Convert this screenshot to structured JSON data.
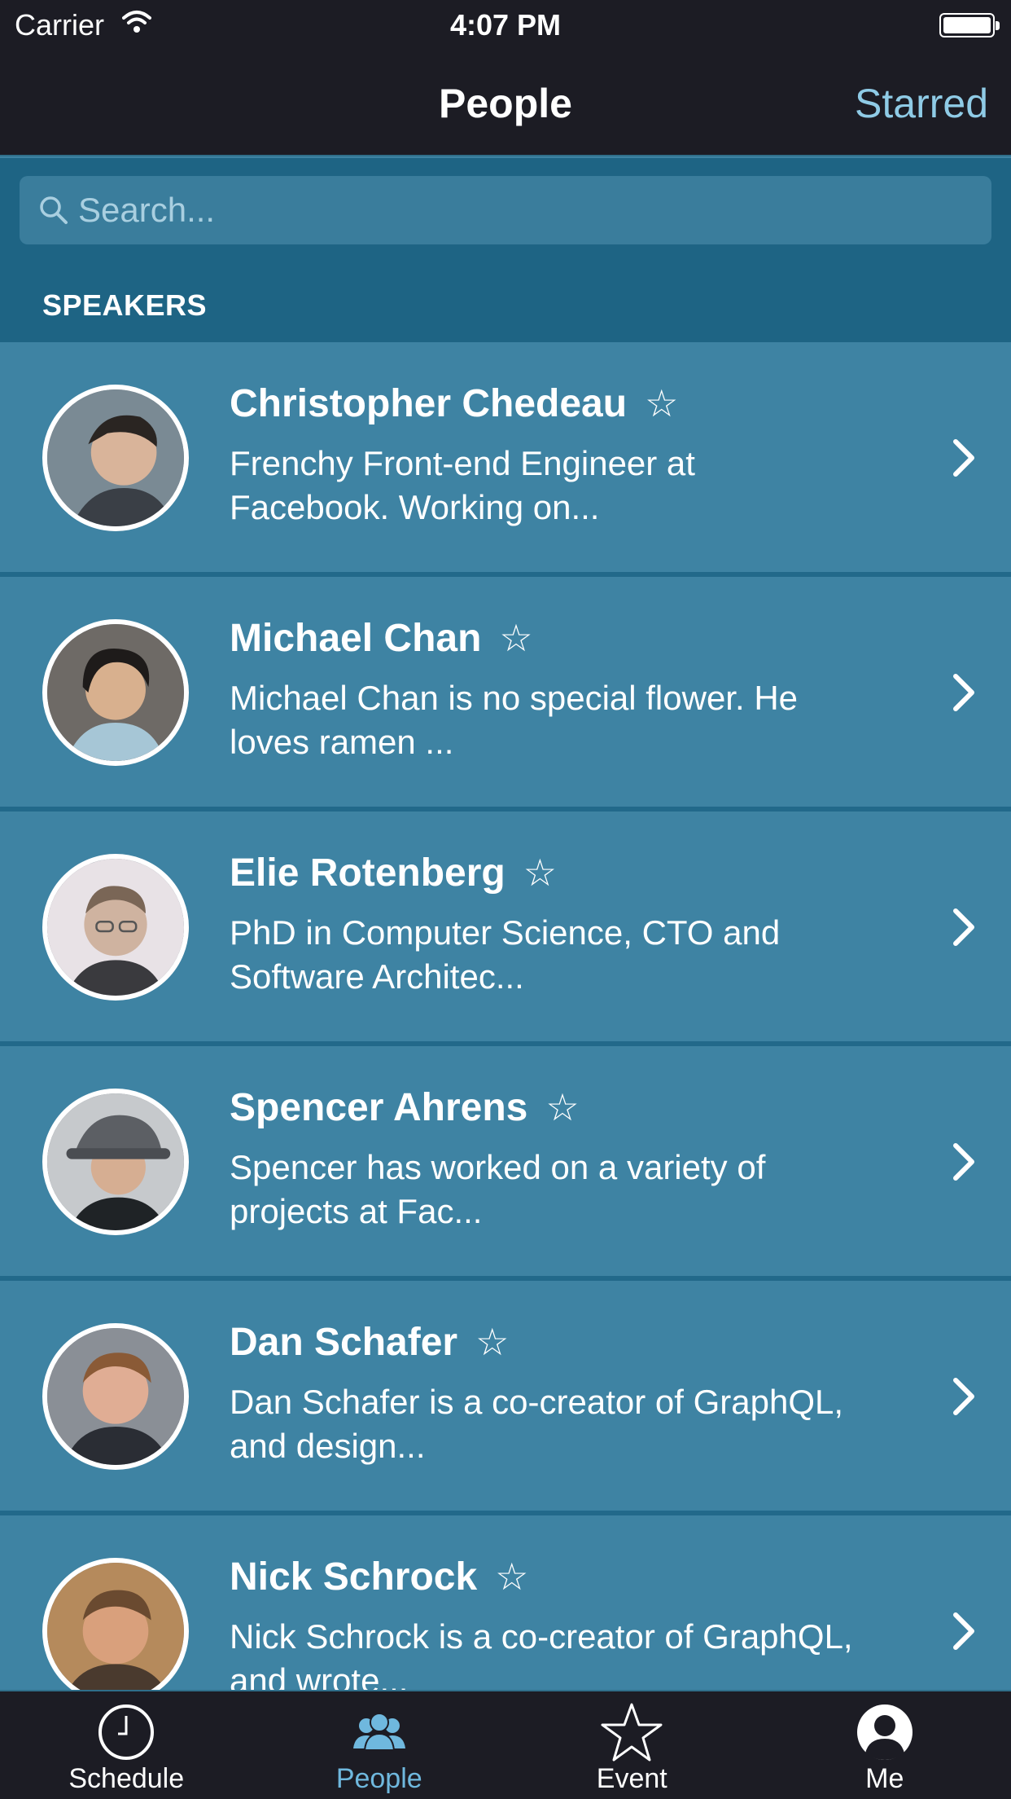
{
  "status_bar": {
    "carrier": "Carrier",
    "time": "4:07 PM"
  },
  "nav": {
    "title": "People",
    "right_action": "Starred"
  },
  "search": {
    "placeholder": "Search...",
    "value": ""
  },
  "section": {
    "title": "SPEAKERS"
  },
  "people": [
    {
      "name": "Christopher Chedeau",
      "bio_line1": "Frenchy Front-end Engineer at",
      "bio_line2": "Facebook. Working on...",
      "starred": false
    },
    {
      "name": "Michael Chan",
      "bio_line1": "Michael Chan is no special flower. He",
      "bio_line2": "loves ramen ...",
      "starred": false
    },
    {
      "name": "Elie Rotenberg",
      "bio_line1": "PhD in Computer Science, CTO and",
      "bio_line2": "Software Architec...",
      "starred": false
    },
    {
      "name": "Spencer Ahrens",
      "bio_line1": "Spencer has worked on a variety of",
      "bio_line2": "projects at Fac...",
      "starred": false
    },
    {
      "name": "Dan Schafer",
      "bio_line1": "Dan Schafer is a co-creator of GraphQL,",
      "bio_line2": "and design...",
      "starred": false
    },
    {
      "name": "Nick Schrock",
      "bio_line1": "Nick Schrock is a co-creator of GraphQL,",
      "bio_line2": "and wrote...",
      "starred": false
    }
  ],
  "star_glyph": "☆",
  "tabs": [
    {
      "label": "Schedule",
      "icon": "clock-icon",
      "active": false
    },
    {
      "label": "People",
      "icon": "people-icon",
      "active": true
    },
    {
      "label": "Event",
      "icon": "star-icon",
      "active": false
    },
    {
      "label": "Me",
      "icon": "person-icon",
      "active": false
    }
  ],
  "colors": {
    "bar_background": "#1c1c24",
    "list_background": "#3e83a3",
    "section_background": "#1e6484",
    "accent": "#6fb8de"
  }
}
